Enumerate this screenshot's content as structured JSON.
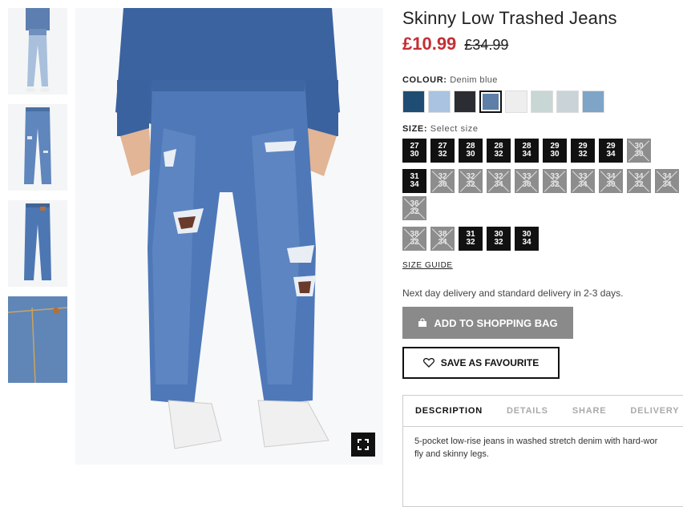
{
  "product": {
    "title": "Skinny Low Trashed Jeans",
    "price_now": "£10.99",
    "price_old": "£34.99"
  },
  "colour": {
    "label": "COLOUR:",
    "value": "Denim blue",
    "swatches": [
      "#1f4c73",
      "#a9c3e0",
      "#2b2d33",
      "#5d7fa8",
      "#eeeeee",
      "#c8d6d4",
      "#c9d3d8",
      "#7ea4c8"
    ],
    "selected_index": 3
  },
  "size": {
    "label": "SIZE:",
    "hint": "Select size",
    "rows": [
      [
        {
          "w": "27",
          "l": "30",
          "a": true
        },
        {
          "w": "27",
          "l": "32",
          "a": true
        },
        {
          "w": "28",
          "l": "30",
          "a": true
        },
        {
          "w": "28",
          "l": "32",
          "a": true
        },
        {
          "w": "28",
          "l": "34",
          "a": true
        },
        {
          "w": "29",
          "l": "30",
          "a": true
        },
        {
          "w": "29",
          "l": "32",
          "a": true
        },
        {
          "w": "29",
          "l": "34",
          "a": true
        },
        {
          "w": "30",
          "l": "30",
          "a": false
        }
      ],
      [
        {
          "w": "31",
          "l": "34",
          "a": true
        },
        {
          "w": "32",
          "l": "30",
          "a": false
        },
        {
          "w": "32",
          "l": "32",
          "a": false
        },
        {
          "w": "32",
          "l": "34",
          "a": false
        },
        {
          "w": "33",
          "l": "30",
          "a": false
        },
        {
          "w": "33",
          "l": "32",
          "a": false
        },
        {
          "w": "33",
          "l": "34",
          "a": false
        },
        {
          "w": "34",
          "l": "30",
          "a": false
        },
        {
          "w": "34",
          "l": "32",
          "a": false
        },
        {
          "w": "34",
          "l": "34",
          "a": false
        },
        {
          "w": "36",
          "l": "32",
          "a": false
        }
      ],
      [
        {
          "w": "38",
          "l": "32",
          "a": false
        },
        {
          "w": "38",
          "l": "34",
          "a": false
        },
        {
          "w": "31",
          "l": "32",
          "a": true
        },
        {
          "w": "30",
          "l": "32",
          "a": true
        },
        {
          "w": "30",
          "l": "34",
          "a": true
        }
      ]
    ],
    "guide": "SIZE GUIDE"
  },
  "delivery": "Next day delivery and standard delivery in 2-3 days.",
  "buttons": {
    "bag": "ADD TO SHOPPING BAG",
    "fav": "SAVE AS FAVOURITE"
  },
  "tabs": [
    "DESCRIPTION",
    "DETAILS",
    "SHARE",
    "DELIVERY"
  ],
  "description": {
    "line1": "5-pocket low-rise jeans in washed stretch denim with hard-wor",
    "line2": "fly and skinny legs."
  },
  "icons": [
    "zoom-icon",
    "bag-icon",
    "heart-icon"
  ]
}
